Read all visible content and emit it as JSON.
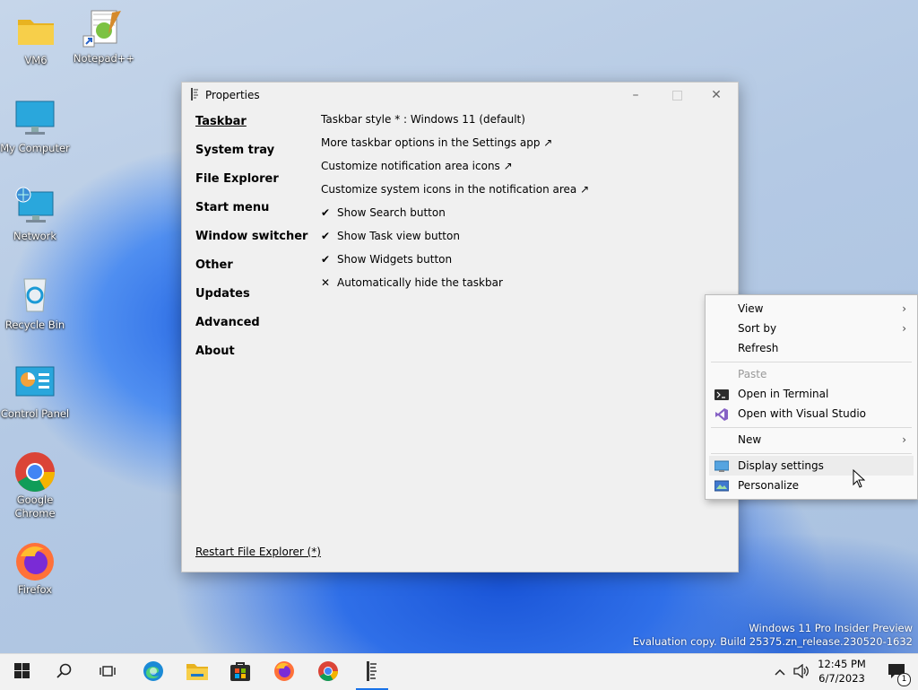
{
  "desktop": {
    "icons": [
      {
        "label": "VM6"
      },
      {
        "label": "Notepad++"
      },
      {
        "label": "My Computer"
      },
      {
        "label": "Network"
      },
      {
        "label": "Recycle Bin"
      },
      {
        "label": "Control Panel"
      },
      {
        "label": "Google Chrome"
      },
      {
        "label": "Firefox"
      }
    ],
    "watermark": {
      "line1": "Windows 11 Pro Insider Preview",
      "line2": "Evaluation copy. Build 25375.zn_release.230520-1632"
    }
  },
  "window": {
    "title": "Properties",
    "nav": [
      "Taskbar",
      "System tray",
      "File Explorer",
      "Start menu",
      "Window switcher",
      "Other",
      "Updates",
      "Advanced",
      "About"
    ],
    "selected_nav": "Taskbar",
    "options": [
      {
        "mark": "",
        "label": "Taskbar style * : Windows 11 (default)"
      },
      {
        "mark": "",
        "label": "More taskbar options in the Settings app ↗"
      },
      {
        "mark": "",
        "label": "Customize notification area icons ↗"
      },
      {
        "mark": "",
        "label": "Customize system icons in the notification area ↗"
      },
      {
        "mark": "✔",
        "label": "Show Search button"
      },
      {
        "mark": "✔",
        "label": "Show Task view button"
      },
      {
        "mark": "✔",
        "label": "Show Widgets button"
      },
      {
        "mark": "✕",
        "label": "Automatically hide the taskbar"
      }
    ],
    "restart_label": "Restart File Explorer (*)"
  },
  "context_menu": {
    "items": [
      {
        "label": "View",
        "submenu": true
      },
      {
        "label": "Sort by",
        "submenu": true
      },
      {
        "label": "Refresh"
      },
      {
        "label": "Paste",
        "disabled": true
      },
      {
        "label": "Open in Terminal",
        "icon": "terminal-icon"
      },
      {
        "label": "Open with Visual Studio",
        "icon": "visual-studio-icon"
      },
      {
        "label": "New",
        "submenu": true
      },
      {
        "label": "Display settings",
        "icon": "display-icon"
      },
      {
        "label": "Personalize",
        "icon": "personalize-icon"
      }
    ],
    "submenu_glyph": "›"
  },
  "taskbar": {
    "apps": [
      "start-icon",
      "search-icon",
      "task-view-icon",
      "edge-icon",
      "file-explorer-icon",
      "store-icon",
      "firefox-icon",
      "chrome-icon",
      "properties-app-icon"
    ],
    "active_app": "properties-app-icon",
    "time": "12:45 PM",
    "date": "6/7/2023",
    "notification_count": "1"
  },
  "colors": {
    "accent": "#1a73e8",
    "window_bg": "#f0f0f0"
  }
}
